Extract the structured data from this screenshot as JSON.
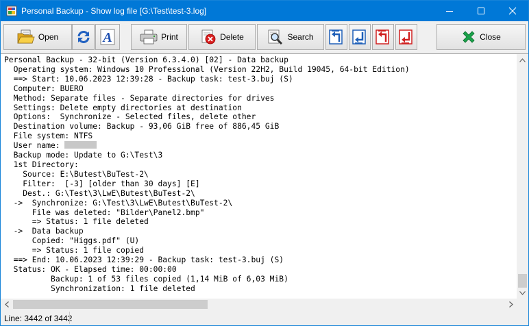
{
  "window": {
    "title": "Personal Backup - Show log file [G:\\Test\\test-3.log]"
  },
  "toolbar": {
    "open_label": "Open",
    "print_label": "Print",
    "delete_label": "Delete",
    "search_label": "Search",
    "close_label": "Close"
  },
  "log": {
    "lines": [
      "Personal Backup - 32-bit (Version 6.3.4.0) [02] - Data backup",
      "  Operating system: Windows 10 Professional (Version 22H2, Build 19045, 64-bit Edition)",
      "  ==> Start: 10.06.2023 12:39:28 - Backup task: test-3.buj (S)",
      "  Computer: BUERO",
      "  Method: Separate files - Separate directories for drives",
      "  Settings: Delete empty directories at destination",
      "  Options:  Synchronize - Selected files, delete other",
      "  Destination volume: Backup - 93,06 GiB free of 886,45 GiB",
      "  File system: NTFS",
      "  User name: ",
      "  Backup mode: Update to G:\\Test\\3",
      "  1st Directory:",
      "    Source: E:\\Butest\\BuTest-2\\",
      "    Filter:  [-3] [older than 30 days] [E]",
      "    Dest.: G:\\Test\\3\\LwE\\Butest\\BuTest-2\\",
      "  ->  Synchronize: G:\\Test\\3\\LwE\\Butest\\BuTest-2\\",
      "      File was deleted: \"Bilder\\Panel2.bmp\"",
      "      => Status: 1 file deleted",
      "  ->  Data backup",
      "      Copied: \"Higgs.pdf\" (U)",
      "      => Status: 1 file copied",
      "  ==> End: 10.06.2023 12:39:29 - Backup task: test-3.buj (S)",
      "  Status: OK - Elapsed time: 00:00:00",
      "          Backup: 1 of 53 files copied (1,14 MiB of 6,03 MiB)",
      "          Synchronization: 1 file deleted"
    ]
  },
  "status": {
    "line_info": "Line: 3442 of 3442"
  },
  "icons": {
    "app": "app-icon",
    "open": "folder-open-icon",
    "reload": "reload-icon",
    "font": "font-icon",
    "print": "printer-icon",
    "delete": "delete-icon",
    "search": "search-icon",
    "nav1": "jump-first-icon",
    "nav2": "jump-next-icon",
    "nav3": "jump-prev-icon",
    "nav4": "jump-last-icon",
    "close": "close-x-icon"
  },
  "colors": {
    "titlebar": "#0078d7",
    "nav_blue": "#1e5fb8",
    "nav_red": "#d02020",
    "close_green": "#1aa34a"
  }
}
